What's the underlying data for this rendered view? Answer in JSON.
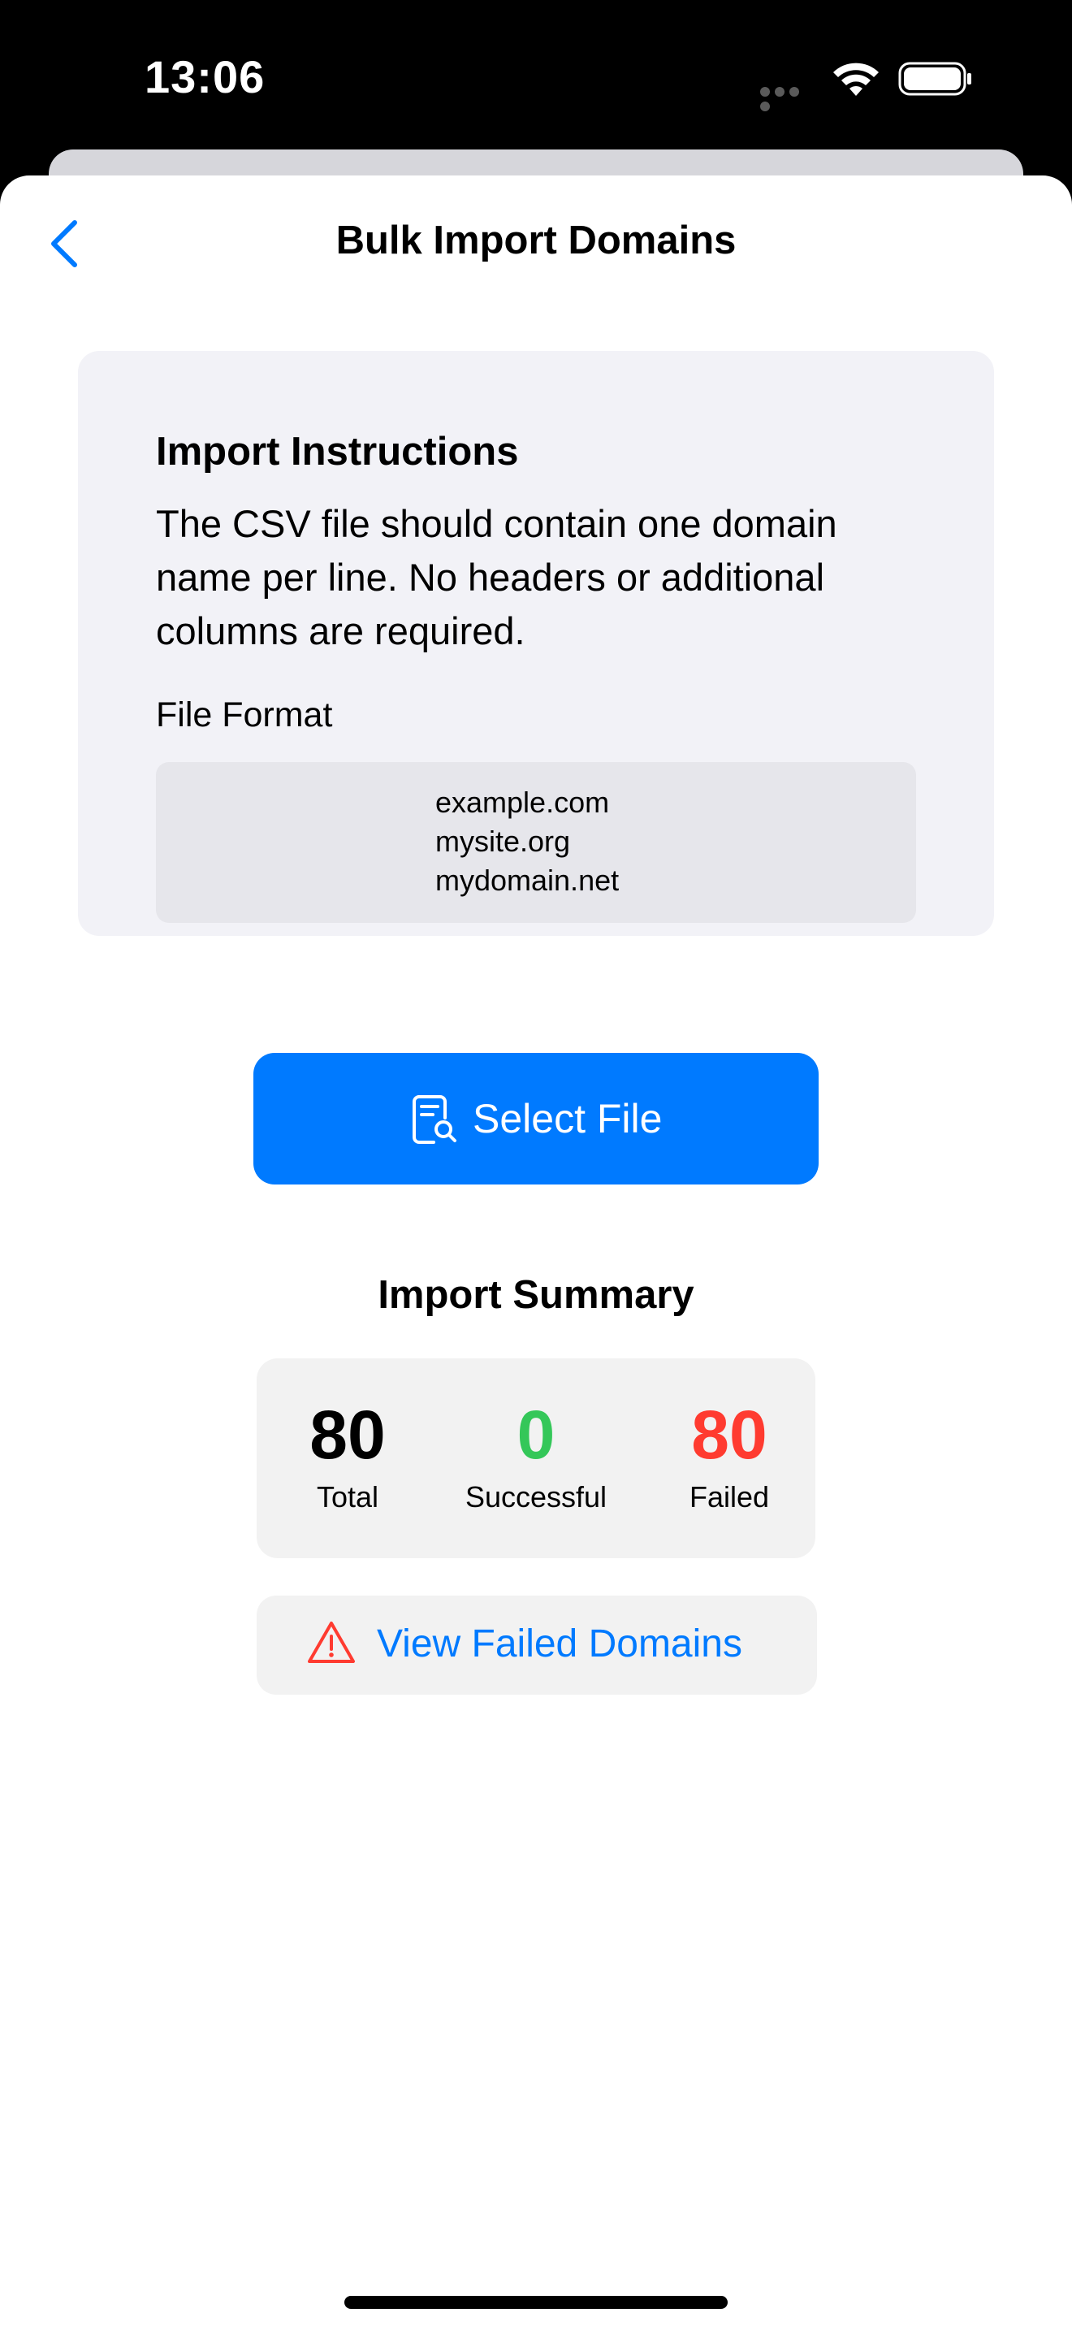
{
  "status_bar": {
    "time": "13:06"
  },
  "nav": {
    "title": "Bulk Import Domains"
  },
  "instructions": {
    "title": "Import Instructions",
    "body": "The CSV file should contain one domain name per line. No headers or additional columns are required.",
    "format_label": "File Format",
    "format_examples": [
      "example.com",
      "mysite.org",
      "mydomain.net"
    ]
  },
  "select_file": {
    "label": "Select File",
    "icon": "document-search-icon"
  },
  "summary": {
    "title": "Import Summary",
    "stats": [
      {
        "value": "80",
        "label": "Total",
        "color": "#000000"
      },
      {
        "value": "0",
        "label": "Successful",
        "color": "#34c759"
      },
      {
        "value": "80",
        "label": "Failed",
        "color": "#ff3b30"
      }
    ]
  },
  "view_failed": {
    "label": "View Failed Domains",
    "icon": "warning-icon",
    "icon_color": "#ff3b30"
  },
  "colors": {
    "accent": "#007aff",
    "card_background": "#f2f2f7",
    "success": "#34c759",
    "failure": "#ff3b30"
  }
}
